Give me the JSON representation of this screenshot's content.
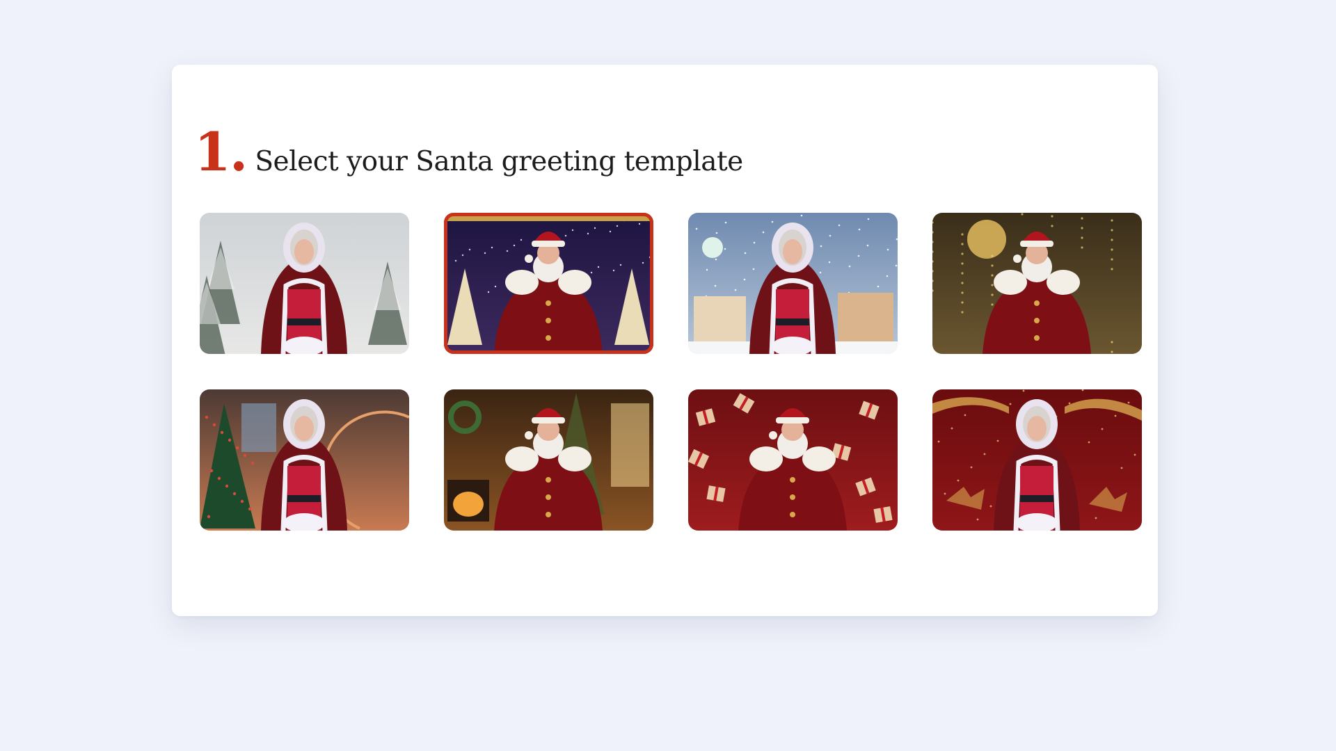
{
  "step": {
    "number": "1.",
    "title": "Select your Santa greeting template"
  },
  "templates": [
    {
      "character": "Mrs. Claus",
      "scene": "snowy pine forest",
      "selected": false,
      "bg_top": "#cfd3d6",
      "bg_bottom": "#e7e7e6",
      "accent": "#4b5a4d"
    },
    {
      "character": "Santa Claus",
      "scene": "starry night with christmas trees",
      "selected": true,
      "bg_top": "#1d1440",
      "bg_bottom": "#3d2a5e",
      "accent": "#e9dcb7"
    },
    {
      "character": "Mrs. Claus",
      "scene": "snowy village night",
      "selected": false,
      "bg_top": "#6f8ab0",
      "bg_bottom": "#b7c6d8",
      "accent": "#ffffff"
    },
    {
      "character": "Santa Claus",
      "scene": "golden bauble bokeh",
      "selected": false,
      "bg_top": "#3a2e1a",
      "bg_bottom": "#6a5630",
      "accent": "#d7b25a"
    },
    {
      "character": "Mrs. Claus",
      "scene": "decorated living room",
      "selected": false,
      "bg_top": "#4d3a34",
      "bg_bottom": "#c87a52",
      "accent": "#d84a3a"
    },
    {
      "character": "Santa Claus",
      "scene": "fireplace room",
      "selected": false,
      "bg_top": "#3a2412",
      "bg_bottom": "#8a5424",
      "accent": "#f2a33a"
    },
    {
      "character": "Santa Claus",
      "scene": "falling gift boxes",
      "selected": false,
      "bg_top": "#6d0f12",
      "bg_bottom": "#9e1c1e",
      "accent": "#e6c8a6"
    },
    {
      "character": "Mrs. Claus",
      "scene": "red reindeer sparkle",
      "selected": false,
      "bg_top": "#6a0c0e",
      "bg_bottom": "#8e1618",
      "accent": "#d8a950"
    }
  ]
}
